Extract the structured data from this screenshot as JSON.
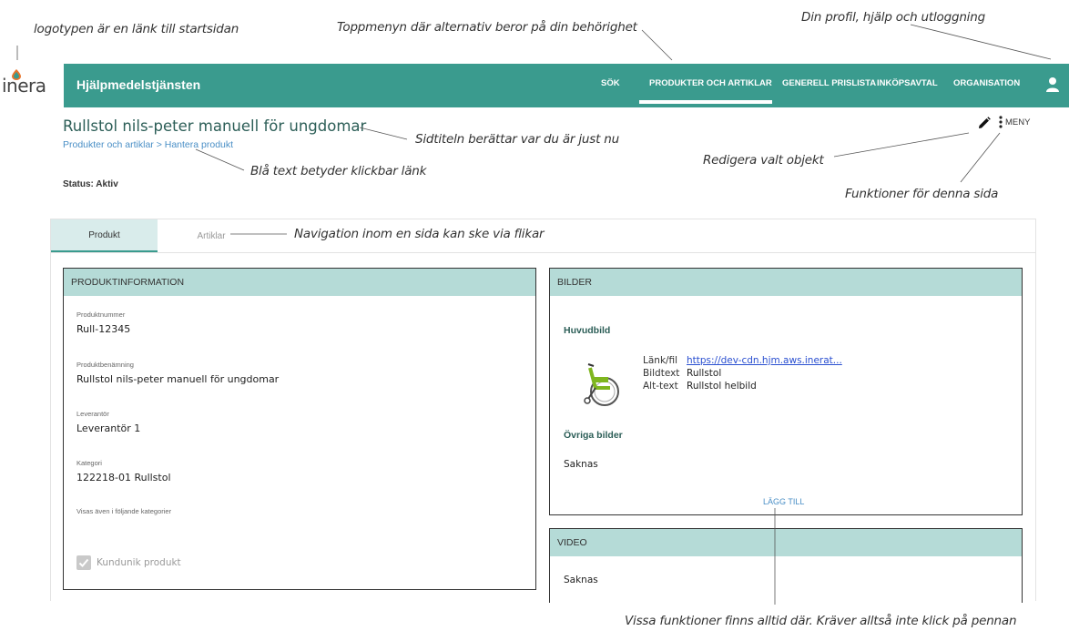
{
  "annotations": {
    "logo": "logotypen är en länk till startsidan",
    "topmenu": "Toppmenyn där alternativ beror på din behörighet",
    "profile": "Din profil, hjälp och utloggning",
    "pagetitle": "Sidtiteln berättar var du är just nu",
    "bluelink": "Blå text betyder klickbar länk",
    "edit": "Redigera valt objekt",
    "functions": "Funktioner för denna sida",
    "tabs": "Navigation inom en sida kan ske via flikar",
    "always": "Vissa funktioner finns alltid där. Kräver alltså inte klick på pennan"
  },
  "brand": {
    "logo_text": "inera",
    "app_name": "Hjälpmedelstjänsten",
    "primary_color": "#3a9b8e",
    "panel_header_color": "#b5dbd7",
    "link_color": "#4a8fc6"
  },
  "nav": {
    "items": [
      "SÖK",
      "PRODUKTER OCH ARTIKLAR",
      "GENERELL PRISLISTA",
      "INKÖPSAVTAL",
      "ORGANISATION"
    ],
    "active": "PRODUKTER OCH ARTIKLAR"
  },
  "page": {
    "title": "Rullstol nils-peter manuell för ungdomar",
    "breadcrumb": "Produkter och artiklar > Hantera produkt",
    "status": "Status: Aktiv",
    "menu_label": "MENY"
  },
  "tabs": [
    "Produkt",
    "Artiklar"
  ],
  "produktinfo": {
    "header": "PRODUKTINFORMATION",
    "fields": [
      {
        "label": "Produktnummer",
        "value": "Rull-12345"
      },
      {
        "label": "Produktbenämning",
        "value": "Rullstol nils-peter manuell för ungdomar"
      },
      {
        "label": "Leverantör",
        "value": "Leverantör 1"
      },
      {
        "label": "Kategori",
        "value": "122218-01 Rullstol"
      },
      {
        "label": "Visas även i följande kategorier",
        "value": ""
      }
    ],
    "checkbox_label": "Kundunik produkt"
  },
  "bilder": {
    "header": "BILDER",
    "main_heading": "Huvudbild",
    "link_key": "Länk/fil",
    "link_value": "https://dev-cdn.hjm.aws.inerat...",
    "caption_key": "Bildtext",
    "caption_value": "Rullstol",
    "alt_key": "Alt-text",
    "alt_value": "Rullstol helbild",
    "other_heading": "Övriga bilder",
    "other_value": "Saknas",
    "add_label": "LÄGG TILL"
  },
  "video": {
    "header": "VIDEO",
    "value": "Saknas"
  }
}
